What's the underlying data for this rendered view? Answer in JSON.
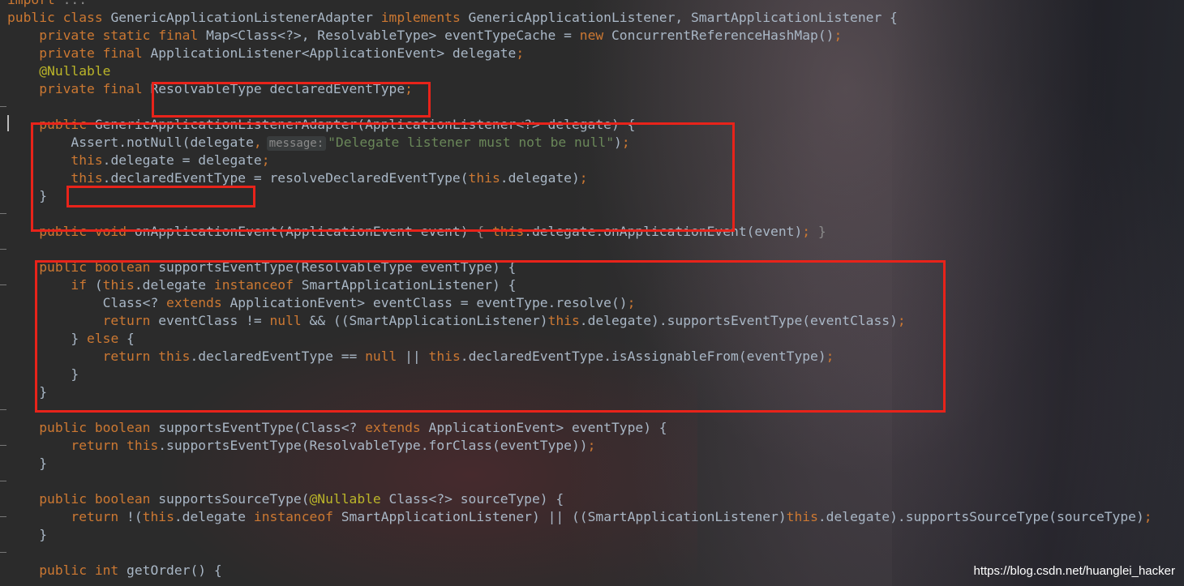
{
  "editor": {
    "lines": [
      {
        "id": "l0",
        "tokens": [
          {
            "c": "kw",
            "t": "import "
          },
          {
            "c": "dim",
            "t": "..."
          }
        ]
      },
      {
        "id": "l1",
        "tokens": [
          {
            "c": "kw",
            "t": "public class "
          },
          {
            "c": "id",
            "t": "GenericApplicationListenerAdapter "
          },
          {
            "c": "kw",
            "t": "implements "
          },
          {
            "c": "id",
            "t": "GenericApplicationListener, SmartApplicationListener {"
          }
        ]
      },
      {
        "id": "l2",
        "tokens": [
          {
            "c": "kw",
            "t": "    private static final "
          },
          {
            "c": "id",
            "t": "Map<Class<?>, ResolvableType> eventTypeCache = "
          },
          {
            "c": "kw",
            "t": "new "
          },
          {
            "c": "id",
            "t": "ConcurrentReferenceHashMap()"
          },
          {
            "c": "kw",
            "t": ";"
          }
        ]
      },
      {
        "id": "l3",
        "tokens": [
          {
            "c": "kw",
            "t": "    private final "
          },
          {
            "c": "id",
            "t": "ApplicationListener<ApplicationEvent> delegate"
          },
          {
            "c": "kw",
            "t": ";"
          }
        ]
      },
      {
        "id": "l4",
        "tokens": [
          {
            "c": "ann",
            "t": "    @Nullable"
          }
        ]
      },
      {
        "id": "l5",
        "tokens": [
          {
            "c": "kw",
            "t": "    private final "
          },
          {
            "c": "id",
            "t": "ResolvableType declaredEventType"
          },
          {
            "c": "kw",
            "t": ";"
          }
        ]
      },
      {
        "id": "l6",
        "tokens": []
      },
      {
        "id": "l7",
        "tokens": [
          {
            "c": "kw",
            "t": "    public "
          },
          {
            "c": "id",
            "t": "GenericApplicationListenerAdapter(ApplicationListener<?> delegate) {"
          }
        ]
      },
      {
        "id": "l8",
        "tokens": [
          {
            "c": "id",
            "t": "        Assert.notNull(delegate"
          },
          {
            "c": "kw",
            "t": ","
          },
          {
            "c": "hint",
            "t": "message:"
          },
          {
            "c": "str",
            "t": "\"Delegate listener must not be null\""
          },
          {
            "c": "id",
            "t": ")"
          },
          {
            "c": "kw",
            "t": ";"
          }
        ]
      },
      {
        "id": "l9",
        "tokens": [
          {
            "c": "kw",
            "t": "        this"
          },
          {
            "c": "id",
            "t": ".delegate = delegate"
          },
          {
            "c": "kw",
            "t": ";"
          }
        ]
      },
      {
        "id": "l10",
        "tokens": [
          {
            "c": "kw",
            "t": "        this"
          },
          {
            "c": "id",
            "t": ".declaredEventType = resolveDeclaredEventType("
          },
          {
            "c": "kw",
            "t": "this"
          },
          {
            "c": "id",
            "t": ".delegate)"
          },
          {
            "c": "kw",
            "t": ";"
          }
        ]
      },
      {
        "id": "l11",
        "tokens": [
          {
            "c": "id",
            "t": "    }"
          }
        ]
      },
      {
        "id": "l12",
        "tokens": []
      },
      {
        "id": "l13",
        "tokens": [
          {
            "c": "kw",
            "t": "    public void "
          },
          {
            "c": "id",
            "t": "onApplicationEvent(ApplicationEvent event) "
          },
          {
            "c": "dim",
            "t": "{ "
          },
          {
            "c": "kw",
            "t": "this"
          },
          {
            "c": "id",
            "t": ".delegate.onApplicationEvent(event)"
          },
          {
            "c": "kw",
            "t": "; "
          },
          {
            "c": "dim",
            "t": "}"
          }
        ]
      },
      {
        "id": "l14",
        "tokens": []
      },
      {
        "id": "l15",
        "tokens": [
          {
            "c": "kw",
            "t": "    public boolean "
          },
          {
            "c": "id",
            "t": "supportsEventType(ResolvableType eventType) {"
          }
        ]
      },
      {
        "id": "l16",
        "tokens": [
          {
            "c": "kw",
            "t": "        if "
          },
          {
            "c": "id",
            "t": "("
          },
          {
            "c": "kw",
            "t": "this"
          },
          {
            "c": "id",
            "t": ".delegate "
          },
          {
            "c": "kw",
            "t": "instanceof "
          },
          {
            "c": "id",
            "t": "SmartApplicationListener) {"
          }
        ]
      },
      {
        "id": "l17",
        "tokens": [
          {
            "c": "id",
            "t": "            Class<? "
          },
          {
            "c": "kw",
            "t": "extends "
          },
          {
            "c": "id",
            "t": "ApplicationEvent> eventClass = eventType.resolve()"
          },
          {
            "c": "kw",
            "t": ";"
          }
        ]
      },
      {
        "id": "l18",
        "tokens": [
          {
            "c": "kw",
            "t": "            return "
          },
          {
            "c": "id",
            "t": "eventClass != "
          },
          {
            "c": "kw",
            "t": "null "
          },
          {
            "c": "id",
            "t": "&& ((SmartApplicationListener)"
          },
          {
            "c": "kw",
            "t": "this"
          },
          {
            "c": "id",
            "t": ".delegate).supportsEventType(eventClass)"
          },
          {
            "c": "kw",
            "t": ";"
          }
        ]
      },
      {
        "id": "l19",
        "tokens": [
          {
            "c": "id",
            "t": "        } "
          },
          {
            "c": "kw",
            "t": "else "
          },
          {
            "c": "id",
            "t": "{"
          }
        ]
      },
      {
        "id": "l20",
        "tokens": [
          {
            "c": "kw",
            "t": "            return this"
          },
          {
            "c": "id",
            "t": ".declaredEventType == "
          },
          {
            "c": "kw",
            "t": "null "
          },
          {
            "c": "id",
            "t": "|| "
          },
          {
            "c": "kw",
            "t": "this"
          },
          {
            "c": "id",
            "t": ".declaredEventType.isAssignableFrom(eventType)"
          },
          {
            "c": "kw",
            "t": ";"
          }
        ]
      },
      {
        "id": "l21",
        "tokens": [
          {
            "c": "id",
            "t": "        }"
          }
        ]
      },
      {
        "id": "l22",
        "tokens": [
          {
            "c": "id",
            "t": "    }"
          }
        ]
      },
      {
        "id": "l23",
        "tokens": []
      },
      {
        "id": "l24",
        "tokens": [
          {
            "c": "kw",
            "t": "    public boolean "
          },
          {
            "c": "id",
            "t": "supportsEventType(Class<? "
          },
          {
            "c": "kw",
            "t": "extends "
          },
          {
            "c": "id",
            "t": "ApplicationEvent> eventType) {"
          }
        ]
      },
      {
        "id": "l25",
        "tokens": [
          {
            "c": "kw",
            "t": "        return this"
          },
          {
            "c": "id",
            "t": ".supportsEventType(ResolvableType.forClass(eventType))"
          },
          {
            "c": "kw",
            "t": ";"
          }
        ]
      },
      {
        "id": "l26",
        "tokens": [
          {
            "c": "id",
            "t": "    }"
          }
        ]
      },
      {
        "id": "l27",
        "tokens": []
      },
      {
        "id": "l28",
        "tokens": [
          {
            "c": "kw",
            "t": "    public boolean "
          },
          {
            "c": "id",
            "t": "supportsSourceType("
          },
          {
            "c": "ann",
            "t": "@Nullable "
          },
          {
            "c": "id",
            "t": "Class<?> sourceType) {"
          }
        ]
      },
      {
        "id": "l29",
        "tokens": [
          {
            "c": "kw",
            "t": "        return "
          },
          {
            "c": "id",
            "t": "!("
          },
          {
            "c": "kw",
            "t": "this"
          },
          {
            "c": "id",
            "t": ".delegate "
          },
          {
            "c": "kw",
            "t": "instanceof "
          },
          {
            "c": "id",
            "t": "SmartApplicationListener) || ((SmartApplicationListener)"
          },
          {
            "c": "kw",
            "t": "this"
          },
          {
            "c": "id",
            "t": ".delegate).supportsSourceType(sourceType)"
          },
          {
            "c": "kw",
            "t": ";"
          }
        ]
      },
      {
        "id": "l30",
        "tokens": [
          {
            "c": "id",
            "t": "    }"
          }
        ]
      },
      {
        "id": "l31",
        "tokens": []
      },
      {
        "id": "l32",
        "tokens": [
          {
            "c": "kw",
            "t": "    public int "
          },
          {
            "c": "id",
            "t": "getOrder() {"
          }
        ]
      }
    ]
  },
  "watermark": "https://blog.csdn.net/huanglei_hacker",
  "colors": {
    "keyword": "#cc7832",
    "identifier": "#a9b7c6",
    "annotation": "#bbb529",
    "string": "#6a8759",
    "highlight_box": "#e8231a"
  }
}
